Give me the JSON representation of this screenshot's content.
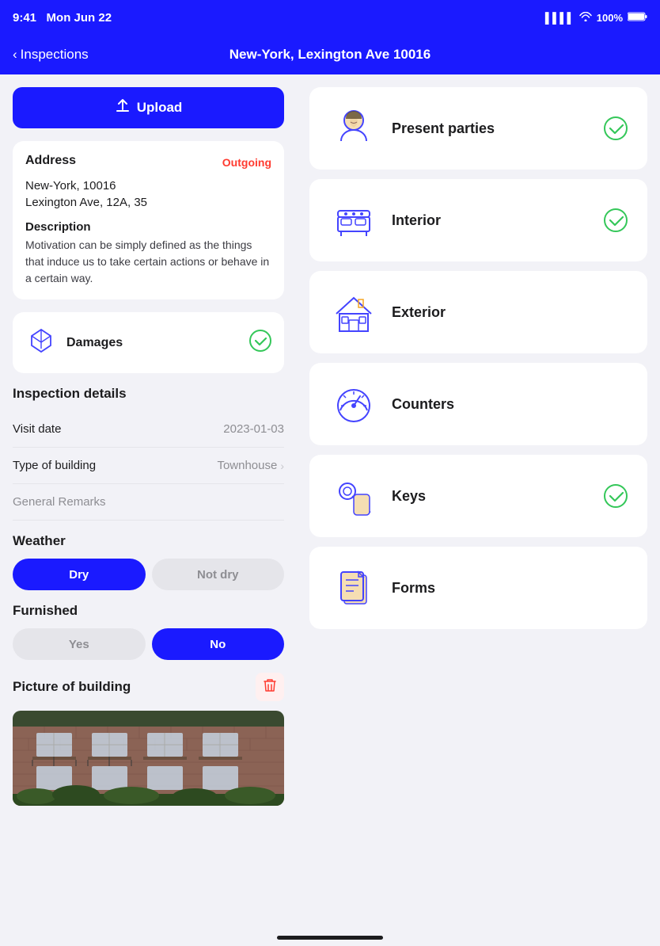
{
  "statusBar": {
    "time": "9:41",
    "date": "Mon Jun 22",
    "signal": "▌▌▌▌",
    "wifi": "wifi",
    "battery": "100%"
  },
  "navBar": {
    "backLabel": "Inspections",
    "title": "New-York, Lexington Ave 10016"
  },
  "leftPanel": {
    "uploadButton": "Upload",
    "addressCard": {
      "title": "Address",
      "badge": "Outgoing",
      "line1": "New-York, 10016",
      "line2": "Lexington Ave, 12A, 35",
      "descriptionTitle": "Description",
      "descriptionText": "Motivation can be simply defined as the things that induce us to take certain actions or behave in a certain way."
    },
    "damagesCard": {
      "label": "Damages"
    },
    "inspectionDetails": {
      "sectionTitle": "Inspection details",
      "visitDateLabel": "Visit date",
      "visitDateValue": "2023-01-03",
      "typeOfBuildingLabel": "Type of building",
      "typeOfBuildingValue": "Townhouse",
      "generalRemarksPlaceholder": "General Remarks"
    },
    "weather": {
      "title": "Weather",
      "options": [
        "Dry",
        "Not dry"
      ],
      "activeOption": "Dry"
    },
    "furnished": {
      "title": "Furnished",
      "options": [
        "Yes",
        "No"
      ],
      "activeOption": "No"
    },
    "pictureOfBuilding": {
      "title": "Picture of building"
    }
  },
  "rightPanel": {
    "cards": [
      {
        "id": "present-parties",
        "label": "Present parties",
        "completed": true
      },
      {
        "id": "interior",
        "label": "Interior",
        "completed": true
      },
      {
        "id": "exterior",
        "label": "Exterior",
        "completed": false
      },
      {
        "id": "counters",
        "label": "Counters",
        "completed": false
      },
      {
        "id": "keys",
        "label": "Keys",
        "completed": true
      },
      {
        "id": "forms",
        "label": "Forms",
        "completed": false
      }
    ]
  }
}
